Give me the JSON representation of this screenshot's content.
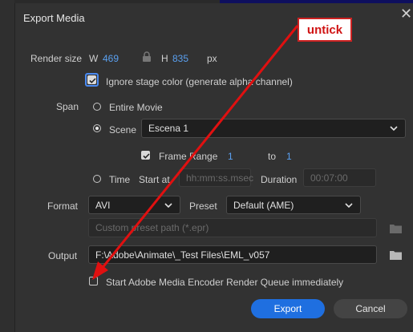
{
  "dialog": {
    "title": "Export Media",
    "render_size_label": "Render size",
    "width_label": "W",
    "width_value": "469",
    "height_label": "H",
    "height_value": "835",
    "unit_label": "px",
    "ignore_stage_label": "Ignore stage color (generate alpha channel)",
    "ignore_stage_checked": true,
    "span_label": "Span",
    "entire_movie_label": "Entire Movie",
    "scene_label": "Scene",
    "scene_value": "Escena 1",
    "frame_range_label": "Frame Range",
    "frame_from": "1",
    "to_label": "to",
    "frame_to": "1",
    "time_label": "Time",
    "start_at_label": "Start at",
    "start_at_placeholder": "hh:mm:ss.msec",
    "duration_label": "Duration",
    "duration_value": "00:07:00",
    "format_label": "Format",
    "format_value": "AVI",
    "preset_label": "Preset",
    "preset_value": "Default (AME)",
    "custom_preset_placeholder": "Custom preset path (*.epr)",
    "output_label": "Output",
    "output_value": "F:\\Adobe\\Animate\\_Test Files\\EML_v057",
    "ame_queue_label": "Start Adobe Media Encoder Render Queue immediately",
    "export_button": "Export",
    "cancel_button": "Cancel"
  },
  "annotation": {
    "callout_text": "untick",
    "color": "#e01010"
  },
  "colors": {
    "accent": "#1f6fe0",
    "link_value": "#5aa0f0"
  }
}
